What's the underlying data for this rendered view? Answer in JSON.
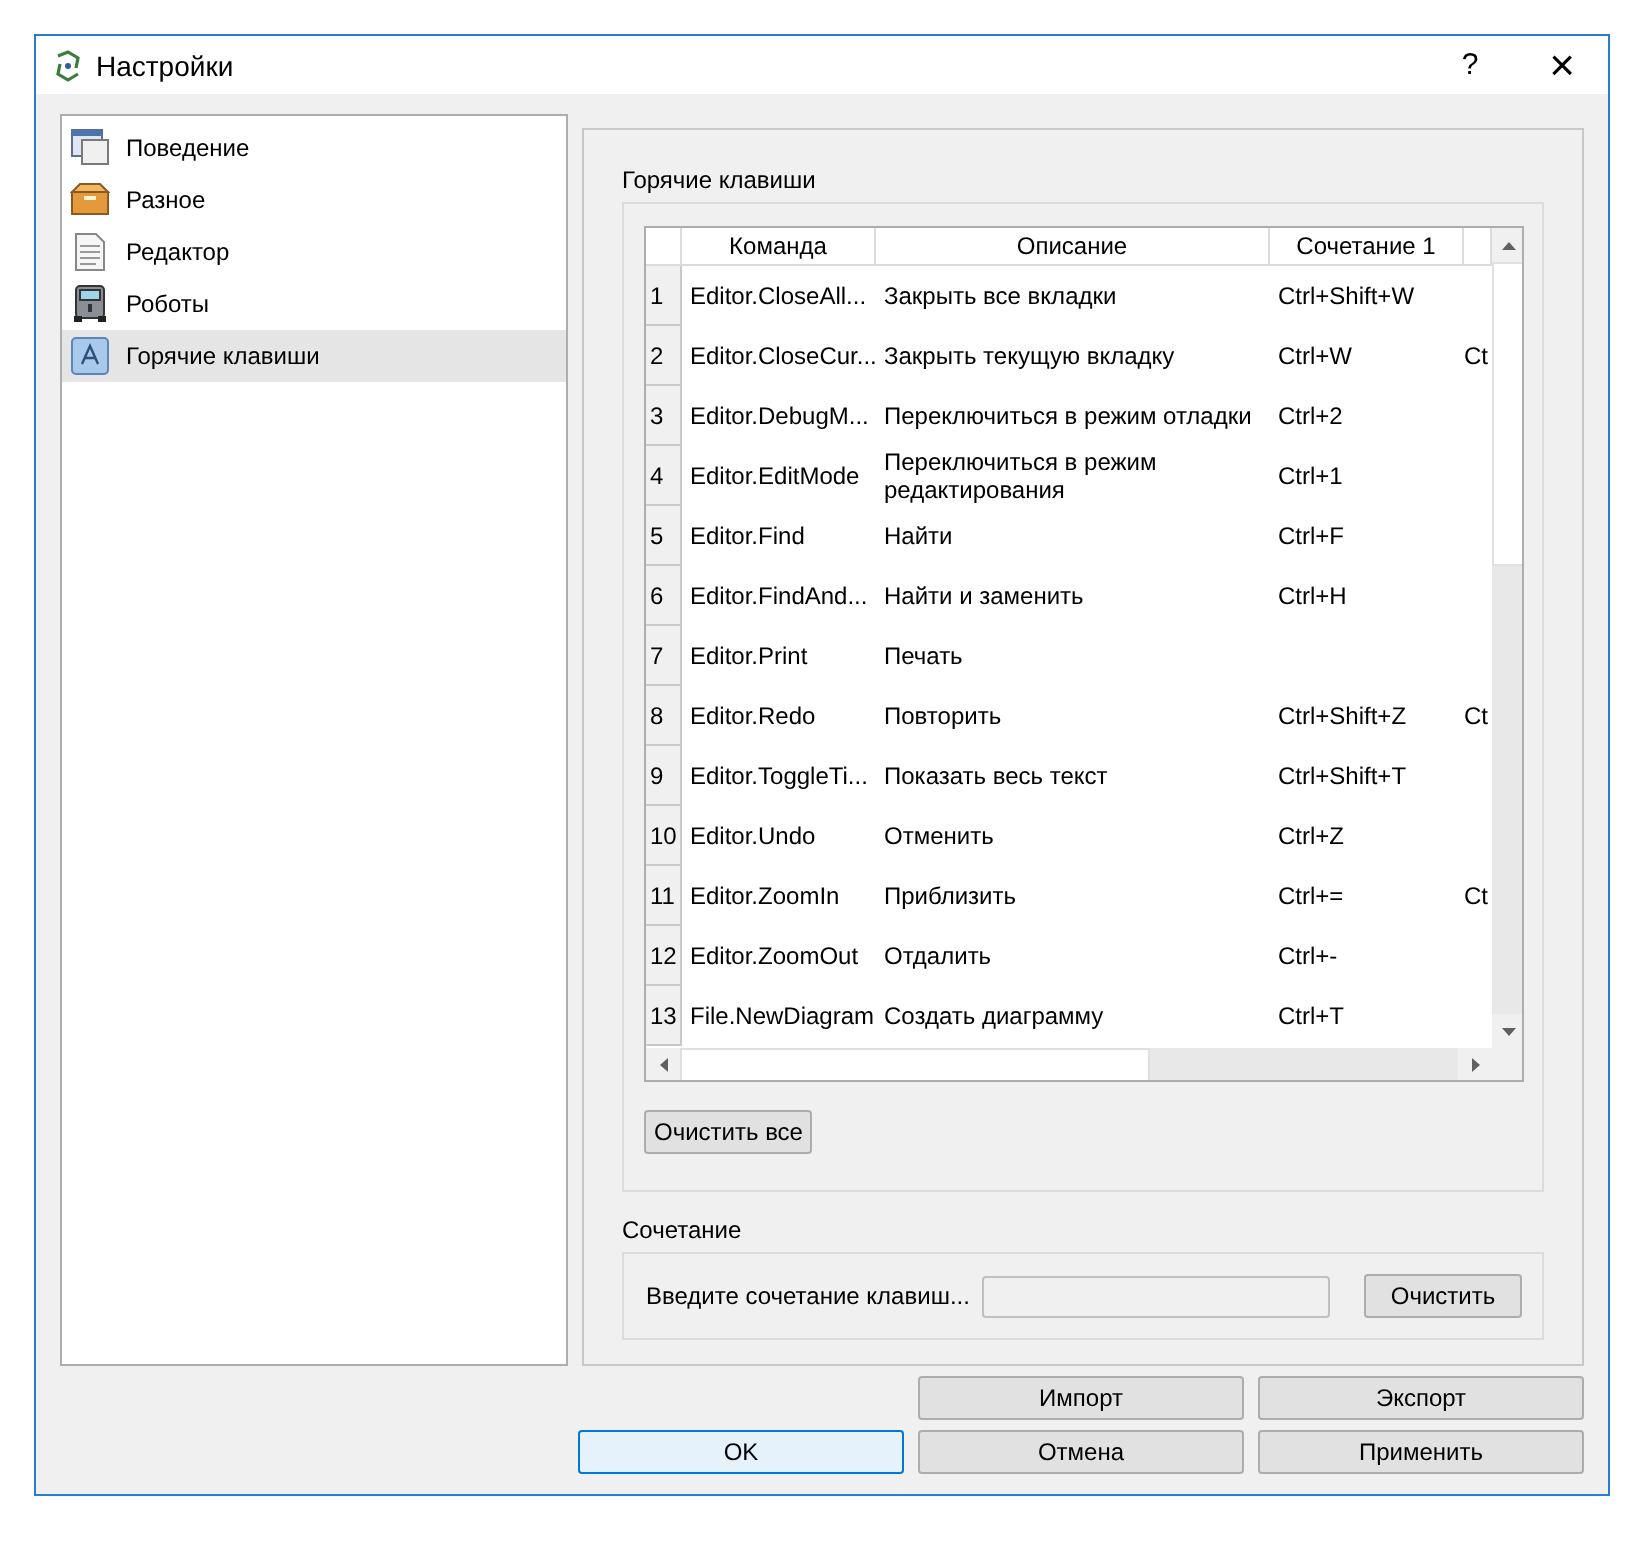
{
  "window": {
    "title": "Настройки",
    "help": "?",
    "close": "×"
  },
  "sidebar": {
    "items": [
      {
        "label": "Поведение",
        "selected": false
      },
      {
        "label": "Разное",
        "selected": false
      },
      {
        "label": "Редактор",
        "selected": false
      },
      {
        "label": "Роботы",
        "selected": false
      },
      {
        "label": "Горячие клавиши",
        "selected": true
      }
    ]
  },
  "hotkeys_group": {
    "title": "Горячие клавиши",
    "table": {
      "columns": [
        "Команда",
        "Описание",
        "Сочетание 1"
      ],
      "rows": [
        {
          "number": "1",
          "command": "Editor.CloseAll...",
          "description": "Закрыть все вкладки",
          "shortcut_1": "Ctrl+Shift+W"
        },
        {
          "number": "2",
          "command": "Editor.CloseCur...",
          "description": "Закрыть текущую вкладку",
          "shortcut_1": "Ctrl+W",
          "column_4": "Ct"
        },
        {
          "number": "3",
          "command": "Editor.DebugM...",
          "description": "Переключиться в режим отладки",
          "shortcut_1": "Ctrl+2"
        },
        {
          "number": "4",
          "command": "Editor.EditMode",
          "description": "Переключиться в режим редактирования",
          "shortcut_1": "Ctrl+1"
        },
        {
          "number": "5",
          "command": "Editor.Find",
          "description": "Найти",
          "shortcut_1": "Ctrl+F"
        },
        {
          "number": "6",
          "command": "Editor.FindAnd...",
          "description": "Найти и заменить",
          "shortcut_1": "Ctrl+H"
        },
        {
          "number": "7",
          "command": "Editor.Print",
          "description": "Печать"
        },
        {
          "number": "8",
          "command": "Editor.Redo",
          "description": "Повторить",
          "shortcut_1": "Ctrl+Shift+Z",
          "column_4": "Ct"
        },
        {
          "number": "9",
          "command": "Editor.ToggleTi...",
          "description": "Показать весь текст",
          "shortcut_1": "Ctrl+Shift+T"
        },
        {
          "number": "10",
          "command": "Editor.Undo",
          "description": "Отменить",
          "shortcut_1": "Ctrl+Z"
        },
        {
          "number": "11",
          "command": "Editor.ZoomIn",
          "description": "Приблизить",
          "shortcut_1": "Ctrl+=",
          "column_4": "Ct"
        },
        {
          "number": "12",
          "command": "Editor.ZoomOut",
          "description": "Отдалить",
          "shortcut_1": "Ctrl+-"
        },
        {
          "number": "13",
          "command": "File.NewDiagram",
          "description": "Создать диаграмму",
          "shortcut_1": "Ctrl+T"
        }
      ]
    },
    "clear_all_button": "Очистить все"
  },
  "shortcut_group": {
    "title": "Сочетание",
    "label": "Введите сочетание клавиш...",
    "clear_button": "Очистить"
  },
  "buttons": [
    {
      "label": "Импорт",
      "focused": false
    },
    {
      "label": "Экспорт",
      "focused": false
    },
    {
      "label": "OK",
      "focused": true
    },
    {
      "label": "Отмена",
      "focused": false
    },
    {
      "label": "Применить",
      "focused": false
    }
  ]
}
